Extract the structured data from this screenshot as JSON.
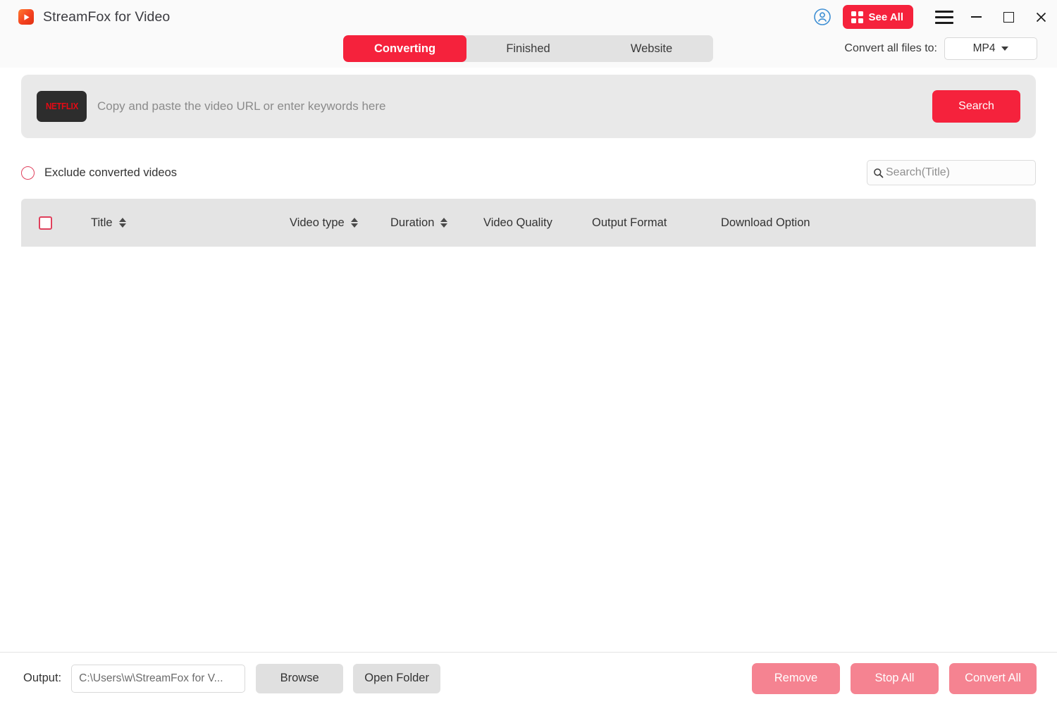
{
  "window": {
    "app_title": "StreamFox for Video",
    "logo_icon": "play-triangle-icon",
    "controls": {
      "account_icon": "user-account-icon",
      "see_all_label": "See All",
      "see_all_icon": "grid-squares-icon",
      "menu_icon": "hamburger-menu-icon",
      "minimize_icon": "minimize-icon",
      "maximize_icon": "maximize-icon",
      "close_icon": "close-icon"
    },
    "accent_color": "#f5223c",
    "titlebar_color": "#fafafa"
  },
  "tabs": [
    {
      "label": "Converting",
      "active": true
    },
    {
      "label": "Finished",
      "active": false
    },
    {
      "label": "Website",
      "active": false
    }
  ],
  "convert_all": {
    "label": "Convert all files to:",
    "selected_format": "MP4",
    "caret_icon": "chevron-down-icon"
  },
  "url_panel": {
    "site_badge": "NETFLIX",
    "url_placeholder": "Copy and paste the video URL or enter keywords here",
    "url_value": "",
    "search_label": "Search"
  },
  "filters": {
    "exclude_label": "Exclude converted videos",
    "exclude_icon": "radio-circle-icon",
    "title_search_placeholder": "Search(Title)",
    "title_search_value": "",
    "search_icon": "magnifier-icon"
  },
  "table": {
    "select_all_icon": "checkbox-icon",
    "columns": [
      {
        "label": "Title",
        "sortable": true
      },
      {
        "label": "Video type",
        "sortable": true
      },
      {
        "label": "Duration",
        "sortable": true
      },
      {
        "label": "Video Quality",
        "sortable": false
      },
      {
        "label": "Output Format",
        "sortable": false
      },
      {
        "label": "Download Option",
        "sortable": false
      }
    ],
    "rows": []
  },
  "bottom": {
    "output_label": "Output:",
    "output_path": "C:\\Users\\w\\StreamFox for V...",
    "browse_label": "Browse",
    "open_folder_label": "Open Folder",
    "remove_label": "Remove",
    "stop_all_label": "Stop All",
    "convert_all_label": "Convert All",
    "disabled_button_color": "#f58391"
  }
}
